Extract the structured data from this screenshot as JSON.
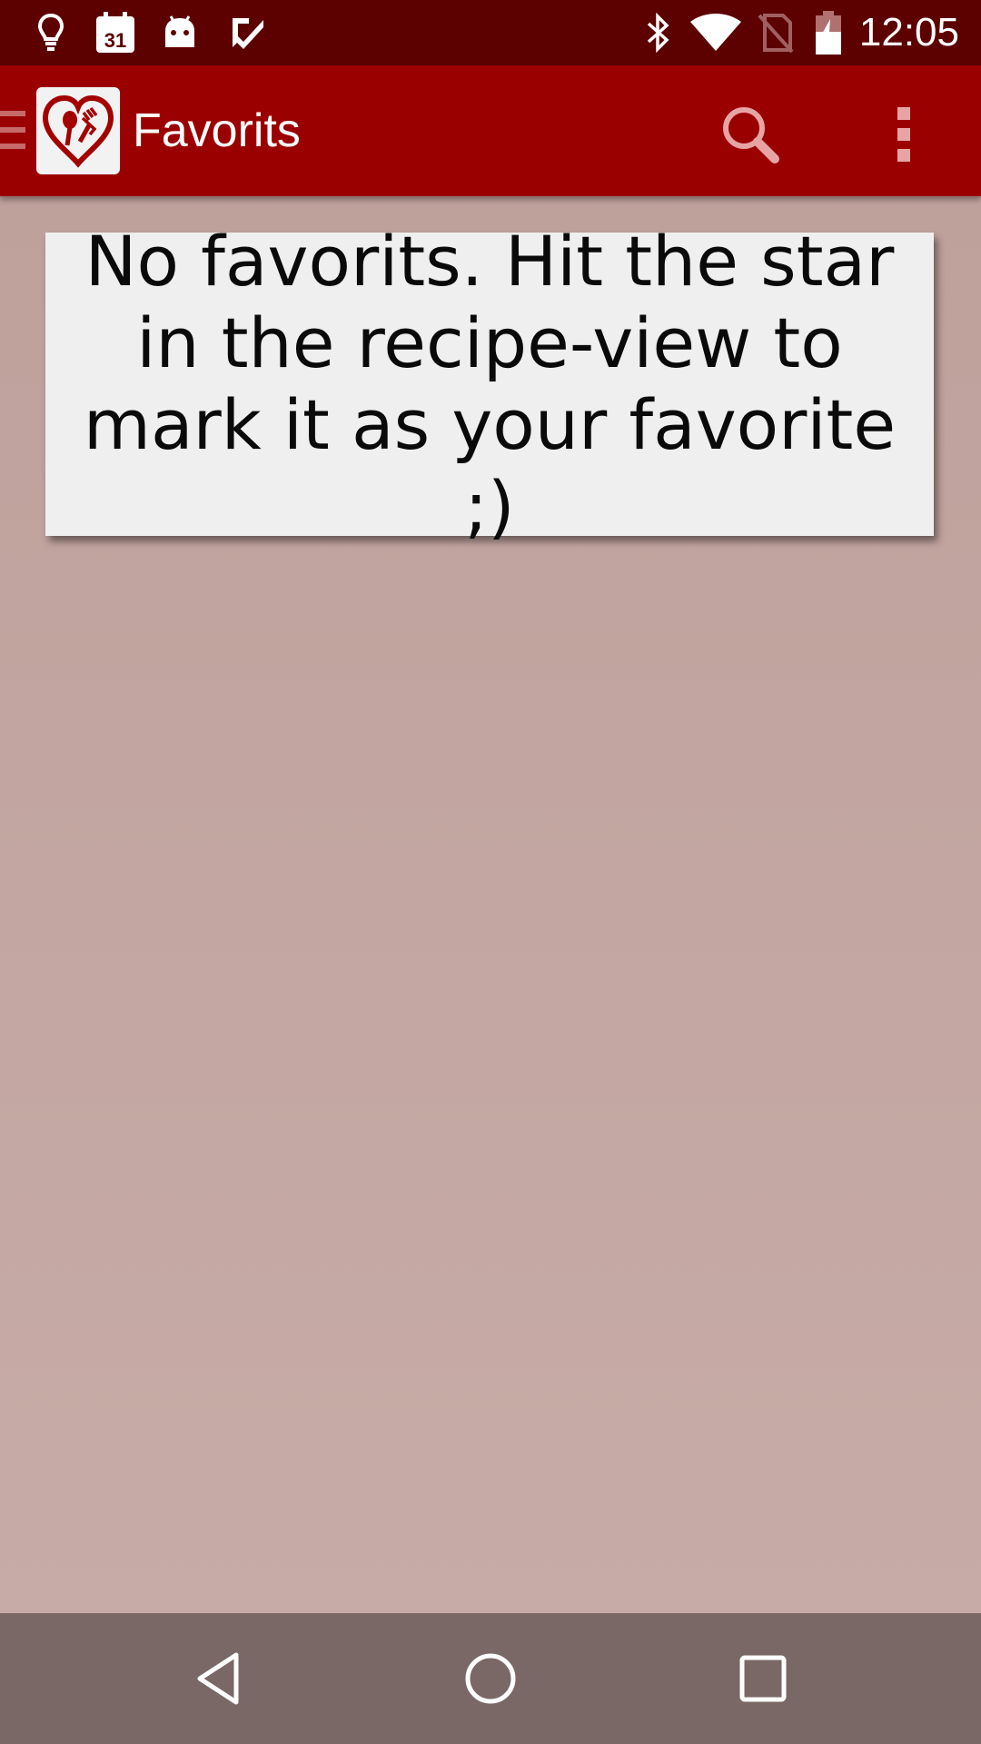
{
  "status_bar": {
    "time": "12:05",
    "left_icons": [
      "lightbulb-icon",
      "calendar-icon",
      "android-icon",
      "check-icon"
    ],
    "calendar_day": "31",
    "right_icons": [
      "bluetooth-icon",
      "wifi-icon",
      "no-sim-icon",
      "battery-charging-icon"
    ]
  },
  "app_bar": {
    "title": "Favorits",
    "actions": [
      "search-icon",
      "overflow-menu-icon"
    ]
  },
  "content": {
    "empty_message": "No favorits. Hit the star in the recipe-view to mark it as your favorite ;)"
  },
  "nav_bar": {
    "buttons": [
      "back-icon",
      "home-icon",
      "recents-icon"
    ]
  },
  "colors": {
    "status_bar": "#5c0000",
    "app_bar": "#9b0000",
    "background": "#c3a7a2",
    "card": "#efefef",
    "nav_bar": "#7a6866"
  }
}
